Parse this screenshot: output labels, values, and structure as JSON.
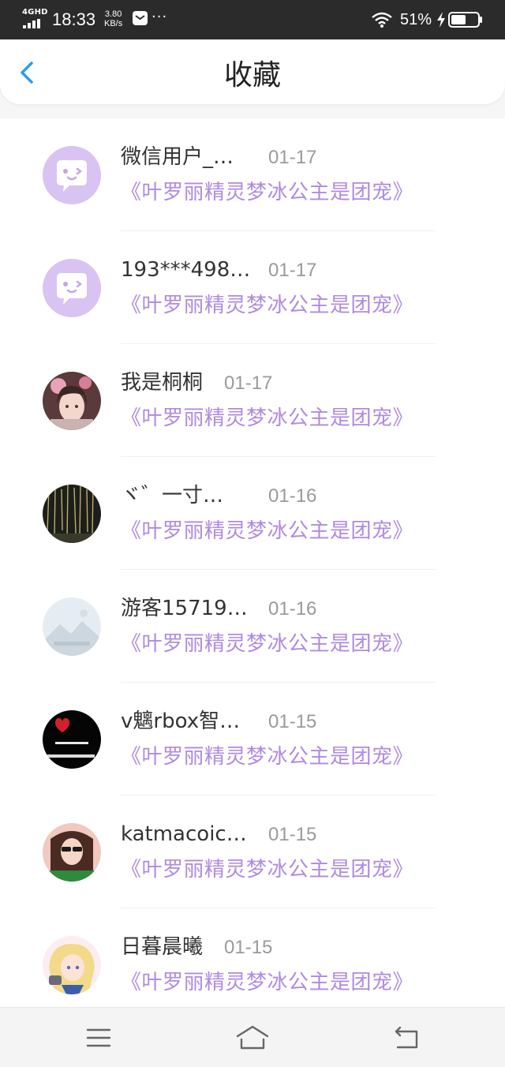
{
  "status_bar": {
    "network": "4GHD",
    "time": "18:33",
    "speed_value": "3.80",
    "speed_unit": "KB/s",
    "notification_dots": "···",
    "battery_percent": "51%",
    "icons": [
      "signal-icon",
      "mail-icon",
      "wifi-icon",
      "charging-icon",
      "battery-icon"
    ]
  },
  "header": {
    "back_icon": "chevron-left-icon",
    "title": "收藏",
    "accent_color": "#2a9df4"
  },
  "favorites": [
    {
      "name": "微信用户_…",
      "date": "01-17",
      "book": "《叶罗丽精灵梦冰公主是团宠》",
      "avatar": "default-purple-avatar"
    },
    {
      "name": "193***498…",
      "date": "01-17",
      "book": "《叶罗丽精灵梦冰公主是团宠》",
      "avatar": "default-purple-avatar"
    },
    {
      "name": "我是桐桐",
      "date": "01-17",
      "book": "《叶罗丽精灵梦冰公主是团宠》",
      "avatar": "anime-girl-avatar"
    },
    {
      "name": "ヾ゛一寸…",
      "date": "01-16",
      "book": "《叶罗丽精灵梦冰公主是团宠》",
      "avatar": "night-lights-avatar"
    },
    {
      "name": "游客15719…",
      "date": "01-16",
      "book": "《叶罗丽精灵梦冰公主是团宠》",
      "avatar": "placeholder-image-avatar"
    },
    {
      "name": "v魑rbox智…",
      "date": "01-15",
      "book": "《叶罗丽精灵梦冰公主是团宠》",
      "avatar": "black-heart-avatar"
    },
    {
      "name": "katmacoic…",
      "date": "01-15",
      "book": "《叶罗丽精灵梦冰公主是团宠》",
      "avatar": "photo-girl-avatar"
    },
    {
      "name": "日暮晨曦",
      "date": "01-15",
      "book": "《叶罗丽精灵梦冰公主是团宠》",
      "avatar": "sailor-moon-avatar"
    }
  ],
  "colors": {
    "book_title": "#b08ae0",
    "date": "#9a9a9a",
    "name": "#333333",
    "default_avatar_bg": "#d9c3f2"
  },
  "nav_bar": {
    "icons": [
      "menu-icon",
      "home-icon",
      "back-icon"
    ]
  }
}
